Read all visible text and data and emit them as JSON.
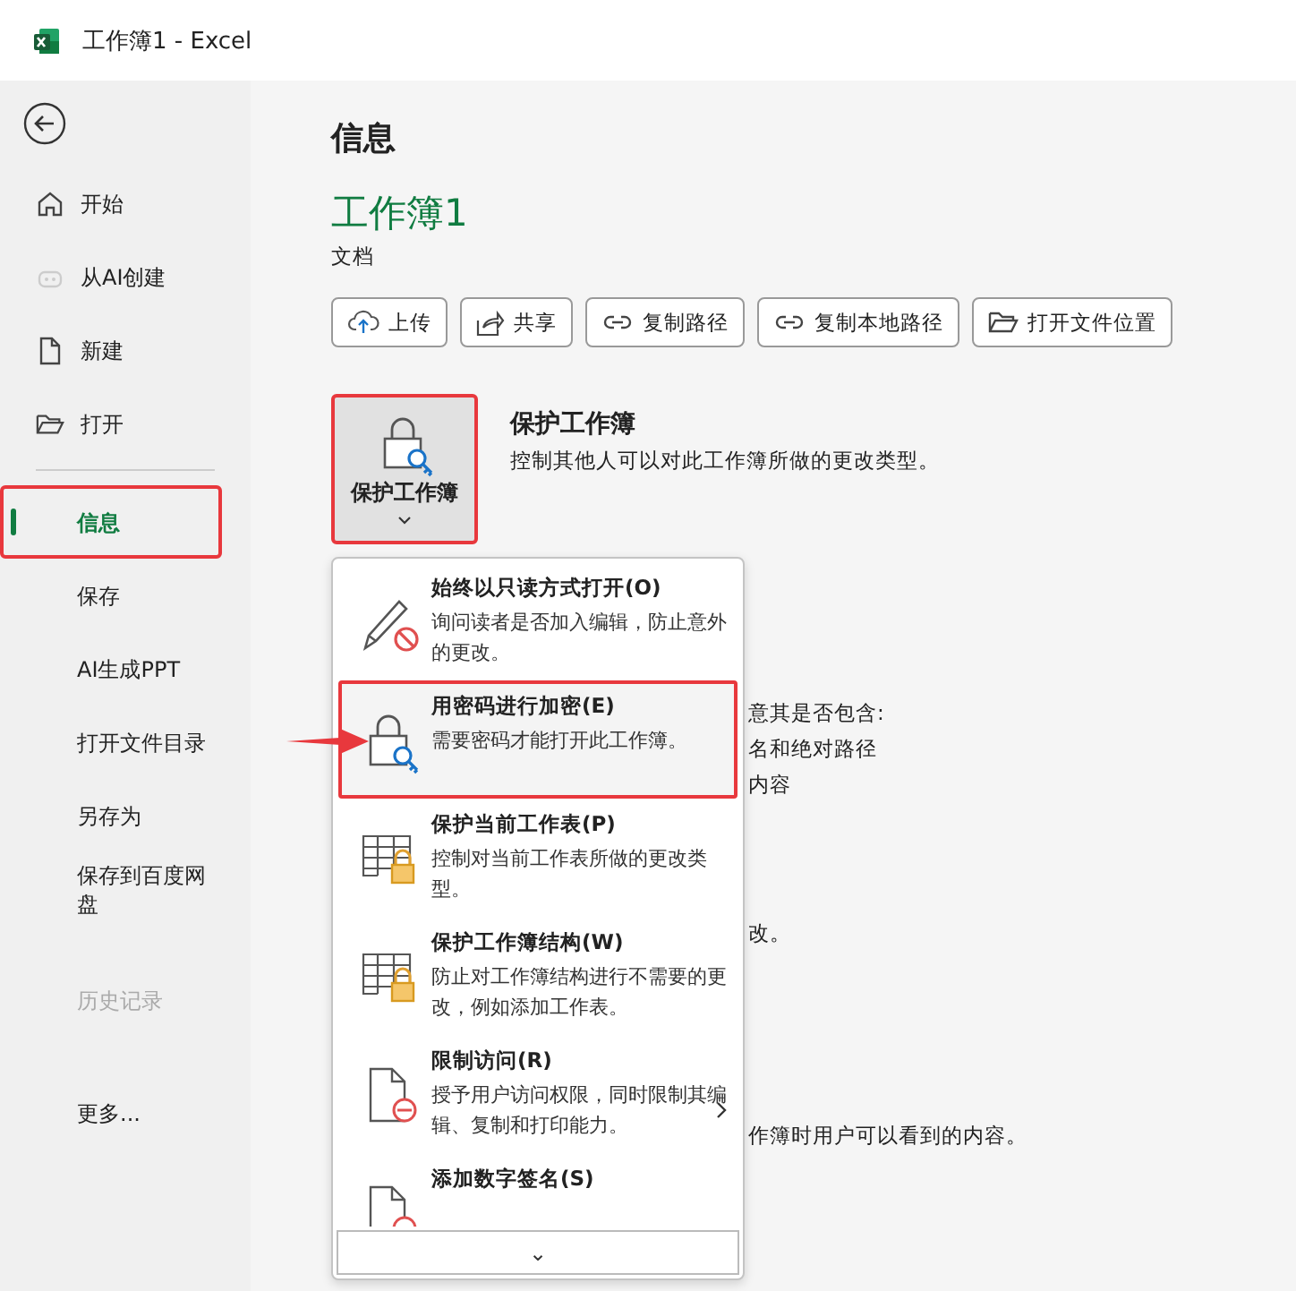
{
  "window": {
    "title": "工作簿1 - Excel"
  },
  "sidebar": {
    "nav": [
      {
        "label": "开始",
        "kind": "home",
        "selected": false,
        "disabled": false,
        "highlighted": false
      },
      {
        "label": "从AI创建",
        "kind": "ai",
        "selected": false,
        "disabled": false,
        "highlighted": false
      },
      {
        "label": "新建",
        "kind": "new",
        "selected": false,
        "disabled": false,
        "highlighted": false
      },
      {
        "label": "打开",
        "kind": "open",
        "selected": false,
        "disabled": false,
        "highlighted": false
      }
    ],
    "commands": [
      {
        "label": "信息",
        "selected": true,
        "disabled": false,
        "highlighted": true
      },
      {
        "label": "保存",
        "selected": false,
        "disabled": false,
        "highlighted": false
      },
      {
        "label": "AI生成PPT",
        "selected": false,
        "disabled": false,
        "highlighted": false
      },
      {
        "label": "打开文件目录",
        "selected": false,
        "disabled": false,
        "highlighted": false
      },
      {
        "label": "另存为",
        "selected": false,
        "disabled": false,
        "highlighted": false
      },
      {
        "label": "保存到百度网盘",
        "selected": false,
        "disabled": false,
        "highlighted": false
      },
      {
        "label": "历史记录",
        "selected": false,
        "disabled": true,
        "highlighted": false
      },
      {
        "label": "更多...",
        "selected": false,
        "disabled": false,
        "highlighted": false
      }
    ]
  },
  "main": {
    "heading": "信息",
    "document_title": "工作簿1",
    "document_type": "文档",
    "actions": [
      {
        "label": "上传",
        "kind": "upload"
      },
      {
        "label": "共享",
        "kind": "share"
      },
      {
        "label": "复制路径",
        "kind": "link"
      },
      {
        "label": "复制本地路径",
        "kind": "link"
      },
      {
        "label": "打开文件位置",
        "kind": "folder"
      }
    ],
    "protect": {
      "button_label": "保护工作簿",
      "title": "保护工作簿",
      "description": "控制其他人可以对此工作簿所做的更改类型。",
      "highlighted": true
    },
    "background_text": [
      [
        "意其是否包含:",
        "名和绝对路径",
        "内容"
      ],
      [
        "改。"
      ],
      [
        "作簿时用户可以看到的内容。"
      ]
    ],
    "menu": {
      "items": [
        {
          "title": "始终以只读方式打开(O)",
          "description": "询问读者是否加入编辑，防止意外的更改。",
          "kind": "pencil-blocked",
          "highlighted": false,
          "submenu": false
        },
        {
          "title": "用密码进行加密(E)",
          "description": "需要密码才能打开此工作簿。",
          "kind": "lock-key",
          "highlighted": true,
          "submenu": false
        },
        {
          "title": "保护当前工作表(P)",
          "description": "控制对当前工作表所做的更改类型。",
          "kind": "sheet-lock",
          "highlighted": false,
          "submenu": false
        },
        {
          "title": "保护工作簿结构(W)",
          "description": "防止对工作簿结构进行不需要的更改，例如添加工作表。",
          "kind": "sheet-lock",
          "highlighted": false,
          "submenu": false
        },
        {
          "title": "限制访问(R)",
          "description": "授予用户访问权限，同时限制其编辑、复制和打印能力。",
          "kind": "doc-blocked",
          "highlighted": false,
          "submenu": true
        },
        {
          "title": "添加数字签名(S)",
          "kind": "doc-blocked",
          "highlighted": false,
          "submenu": false
        }
      ],
      "scroll_label": "⌄"
    }
  }
}
